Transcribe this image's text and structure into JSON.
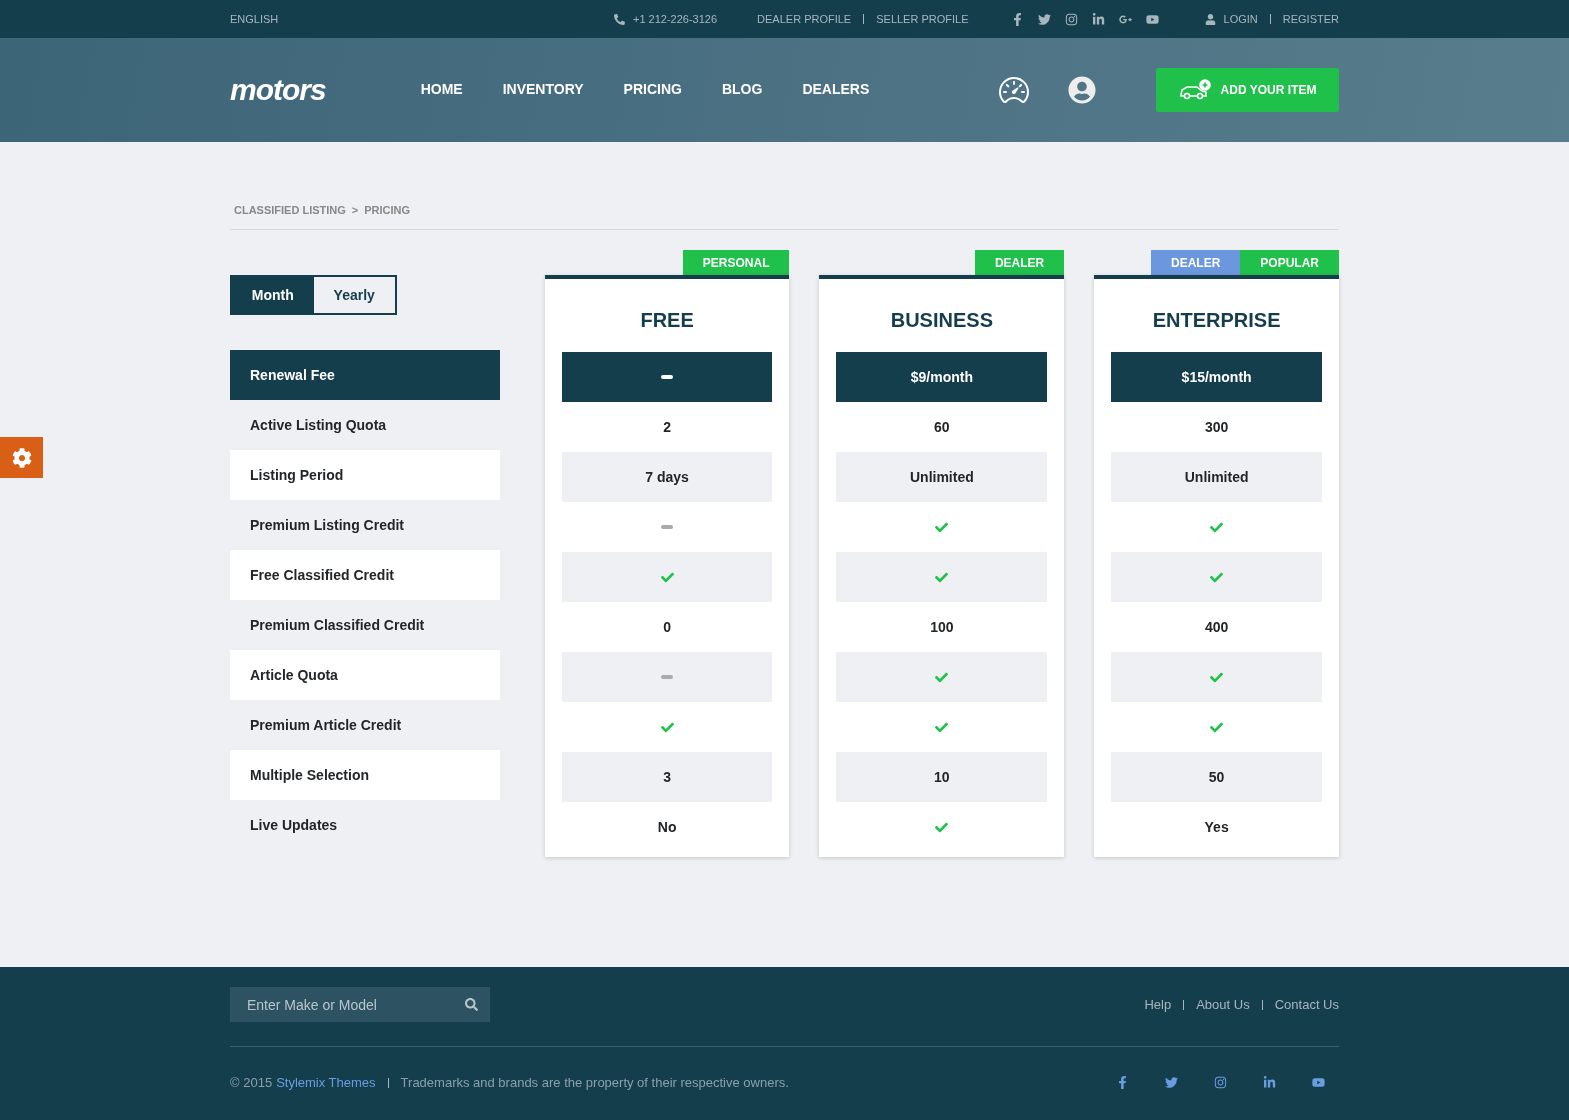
{
  "top_bar": {
    "language": "ENGLISH",
    "phone": "+1 212-226-3126",
    "profile_links": [
      "DEALER PROFILE",
      "SELLER PROFILE"
    ],
    "account_links": [
      "LOGIN",
      "REGISTER"
    ]
  },
  "header": {
    "logo": "motors",
    "nav": [
      {
        "label": "HOME",
        "selected": false
      },
      {
        "label": "INVENTORY",
        "selected": false
      },
      {
        "label": "PRICING",
        "selected": false
      },
      {
        "label": "BLOG",
        "selected": false
      },
      {
        "label": "DEALERS",
        "selected": false
      }
    ],
    "add_button": "ADD YOUR ITEM"
  },
  "breadcrumb": {
    "items": [
      "CLASSIFIED LISTING",
      "PRICING"
    ],
    "separator": ">"
  },
  "billing_toggle": [
    {
      "label": "Month",
      "selected": true
    },
    {
      "label": "Yearly",
      "selected": false
    }
  ],
  "features": [
    {
      "label": "Renewal Fee",
      "kind": "header"
    },
    {
      "label": "Active Listing Quota",
      "kind": "feature"
    },
    {
      "label": "Listing Period",
      "kind": "feature"
    },
    {
      "label": "Premium Listing Credit",
      "kind": "feature"
    },
    {
      "label": "Free Classified Credit",
      "kind": "feature"
    },
    {
      "label": "Premium Classified Credit",
      "kind": "feature"
    },
    {
      "label": "Article Quota",
      "kind": "feature"
    },
    {
      "label": "Premium Article Credit",
      "kind": "feature"
    },
    {
      "label": "Multiple Selection",
      "kind": "feature"
    },
    {
      "label": "Live Updates",
      "kind": "feature"
    }
  ],
  "plans": [
    {
      "name": "FREE",
      "tags": [
        {
          "label": "PERSONAL",
          "color": "#1fc14a"
        }
      ],
      "values": [
        {
          "kind": "dash"
        },
        {
          "kind": "text",
          "text": "2"
        },
        {
          "kind": "text",
          "text": "7 days"
        },
        {
          "kind": "dash"
        },
        {
          "kind": "check"
        },
        {
          "kind": "text",
          "text": "0"
        },
        {
          "kind": "dash"
        },
        {
          "kind": "check"
        },
        {
          "kind": "text",
          "text": "3"
        },
        {
          "kind": "text",
          "text": "No"
        }
      ]
    },
    {
      "name": "BUSINESS",
      "tags": [
        {
          "label": "DEALER",
          "color": "#1fc14a"
        }
      ],
      "values": [
        {
          "kind": "text",
          "text": "$9/month"
        },
        {
          "kind": "text",
          "text": "60"
        },
        {
          "kind": "text",
          "text": "Unlimited"
        },
        {
          "kind": "check"
        },
        {
          "kind": "check"
        },
        {
          "kind": "text",
          "text": "100"
        },
        {
          "kind": "check"
        },
        {
          "kind": "check"
        },
        {
          "kind": "text",
          "text": "10"
        },
        {
          "kind": "check"
        }
      ]
    },
    {
      "name": "ENTERPRISE",
      "tags": [
        {
          "label": "DEALER",
          "color": "#6b97de"
        },
        {
          "label": "POPULAR",
          "color": "#1fc14a"
        }
      ],
      "values": [
        {
          "kind": "text",
          "text": "$15/month"
        },
        {
          "kind": "text",
          "text": "300"
        },
        {
          "kind": "text",
          "text": "Unlimited"
        },
        {
          "kind": "check"
        },
        {
          "kind": "check"
        },
        {
          "kind": "text",
          "text": "400"
        },
        {
          "kind": "check"
        },
        {
          "kind": "check"
        },
        {
          "kind": "text",
          "text": "50"
        },
        {
          "kind": "text",
          "text": "Yes"
        }
      ]
    }
  ],
  "footer": {
    "search": {
      "placeholder": "Enter Make or Model"
    },
    "links": [
      "Help",
      "About Us",
      "Contact Us"
    ],
    "copyright": "© 2015",
    "brand_link": "Stylemix Themes",
    "notice": "Trademarks and brands are the property of their respective owners."
  }
}
